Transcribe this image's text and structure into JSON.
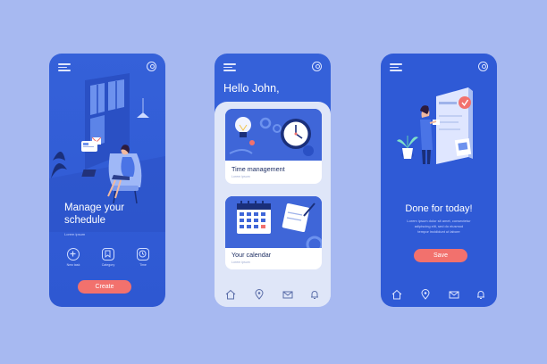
{
  "screens": [
    {
      "title_line1": "Manage your",
      "title_line2": "schedule",
      "sub": "Lorem ipsum",
      "tools": [
        {
          "label": "New task",
          "icon": "plus-circle-icon"
        },
        {
          "label": "Category",
          "icon": "bookmark-icon"
        },
        {
          "label": "Time",
          "icon": "clock-icon"
        }
      ],
      "button": "Create"
    },
    {
      "greeting": "Hello John,",
      "cards": [
        {
          "title": "Time management",
          "sub": "Lorem ipsum"
        },
        {
          "title": "Your calendar",
          "sub": "Lorem ipsum"
        }
      ],
      "nav": [
        "home-icon",
        "location-pin-icon",
        "mail-icon",
        "bell-icon"
      ]
    },
    {
      "title": "Done for today!",
      "desc_line1": "Lorem ipsum dolor sit amet, consectetur",
      "desc_line2": "adipiscing elit, sed do eiusmod",
      "desc_line3": "tempor incididunt ut labore",
      "button": "Save",
      "nav": [
        "home-icon",
        "location-pin-icon",
        "mail-icon",
        "bell-icon"
      ]
    }
  ],
  "colors": {
    "background": "#a7b9f1",
    "primary": "#2f5ad6",
    "accent": "#f2716d",
    "card": "#ffffff"
  }
}
